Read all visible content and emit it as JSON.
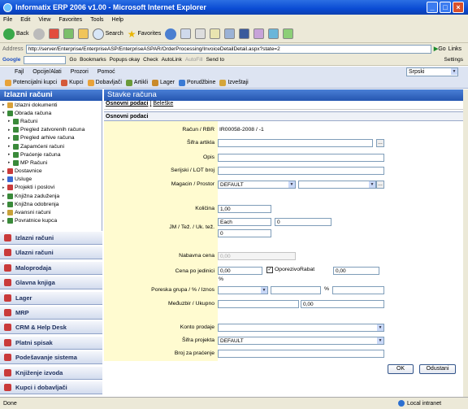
{
  "window": {
    "title": "Informatix ERP 2006 v1.00 - Microsoft Internet Explorer"
  },
  "menubar": [
    "File",
    "Edit",
    "View",
    "Favorites",
    "Tools",
    "Help"
  ],
  "toolbar": {
    "back": "Back",
    "search": "Search",
    "favorites": "Favorites"
  },
  "address": {
    "label": "Address",
    "url": "http://server/Enterprise/EnterpriseASP/EnterpriseASPAR/OrderProcessing/InvoiceDetailDetail.aspx?state=2",
    "go": "Go",
    "links": "Links"
  },
  "google": {
    "logo": "Google",
    "go": "Go",
    "bookmarks": "Bookmarks",
    "popups": "Popups okay",
    "check": "Check",
    "autolink": "AutoLink",
    "autofill": "AutoFill",
    "sendto": "Send to",
    "settings": "Settings"
  },
  "appmenu": [
    "Fajl",
    "Opcije/Alati",
    "Prozori",
    "Pomoć"
  ],
  "language": "Srpski",
  "apptools": [
    "Potencijalni kupci",
    "Kupci",
    "Dobavljači",
    "Artikli",
    "Lager",
    "Porudžbine",
    "Izveštaji"
  ],
  "left": {
    "title": "Izlazni računi",
    "tree": [
      {
        "label": "Izlazni dokumenti",
        "level": 0,
        "exp": "▸"
      },
      {
        "label": "Obrada računa",
        "level": 0,
        "exp": "▾"
      },
      {
        "label": "Računi",
        "level": 1,
        "exp": "▸"
      },
      {
        "label": "Pregled zatvorenih računa",
        "level": 1,
        "exp": "▸"
      },
      {
        "label": "Pregled arhive računa",
        "level": 1,
        "exp": "▸"
      },
      {
        "label": "Zapamćeni računi",
        "level": 1,
        "exp": "▸"
      },
      {
        "label": "Praćenje računa",
        "level": 1,
        "exp": "▸"
      },
      {
        "label": "MP Računi",
        "level": 1,
        "exp": "▸"
      },
      {
        "label": "Dostavnice",
        "level": 0,
        "exp": "▸"
      },
      {
        "label": "Usluge",
        "level": 0,
        "exp": "▸"
      },
      {
        "label": "Projekti i poslovi",
        "level": 0,
        "exp": "▸"
      },
      {
        "label": "Knjižna zaduženja",
        "level": 0,
        "exp": "▸"
      },
      {
        "label": "Knjižna odobrenja",
        "level": 0,
        "exp": "▸"
      },
      {
        "label": "Avansni računi",
        "level": 0,
        "exp": "▸"
      },
      {
        "label": "Povratnice kupca",
        "level": 0,
        "exp": "▸"
      }
    ],
    "nav": [
      "Izlazni računi",
      "Ulazni računi",
      "Maloprodaja",
      "Glavna knjiga",
      "Lager",
      "MRP",
      "CRM & Help Desk",
      "Platni spisak",
      "Podešavanje sistema",
      "Knjiženje izvoda",
      "Kupci i dobavljači"
    ]
  },
  "right": {
    "title": "Stavke računa",
    "tabs": [
      "Osnovni podaci",
      "Beleške"
    ],
    "section": "Osnovni podaci",
    "labels": {
      "racun": "Račun / RBR",
      "sifra": "Šifra artikla",
      "opis": "Opis",
      "serijski": "Serijski / LOT broj",
      "magacin": "Magacin / Prostor",
      "kolicina": "Količina",
      "jm": "JM / Tež. / Uk. tež.",
      "nabavna": "Nabavna cena",
      "cena": "Cena po jedinici",
      "poreska": "Poreska grupa / % / Iznos",
      "medjuzbir": "Međuzbir / Ukupno",
      "konto": "Konto prodaje",
      "projekat": "Šifra projekta",
      "broj": "Broj za praćenje"
    },
    "values": {
      "racun": "IR00058-2008 / -1",
      "magacin": "DEFAULT",
      "kolicina": "1,00",
      "jm": "Each",
      "tez": "0",
      "uktez": "0",
      "nabavna": "0,00",
      "cena": "0,00",
      "oporezivo": "Oporezivo",
      "rabat_label": "Rabat",
      "rabat": "0,00",
      "pct": "%",
      "pct2": "%",
      "ukupno": "0,00",
      "projekat": "DEFAULT"
    },
    "ok": "OK",
    "cancel": "Odustani"
  },
  "status": {
    "text": "Done",
    "zone": "Local intranet"
  }
}
